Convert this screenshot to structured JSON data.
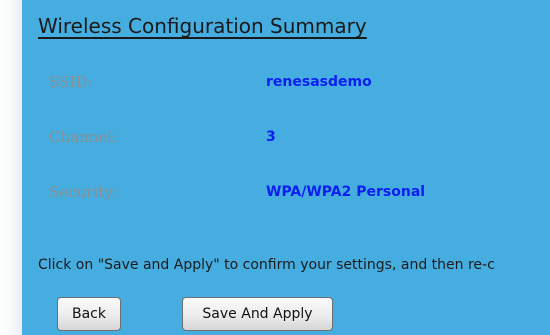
{
  "title": "Wireless Configuration Summary",
  "summary": {
    "rows": [
      {
        "label": "SSID:",
        "value": "renesasdemo"
      },
      {
        "label": "Channel:",
        "value": "3"
      },
      {
        "label": "Security:",
        "value": "WPA/WPA2 Personal"
      }
    ]
  },
  "instruction": "Click on \"Save and Apply\" to confirm your settings, and then re-c",
  "buttons": {
    "back_label": "Back",
    "save_apply_label": "Save And Apply"
  },
  "colors": {
    "panel_background": "#46ade0",
    "label_text": "#8e8e8e",
    "value_text": "#0b1ef2"
  }
}
